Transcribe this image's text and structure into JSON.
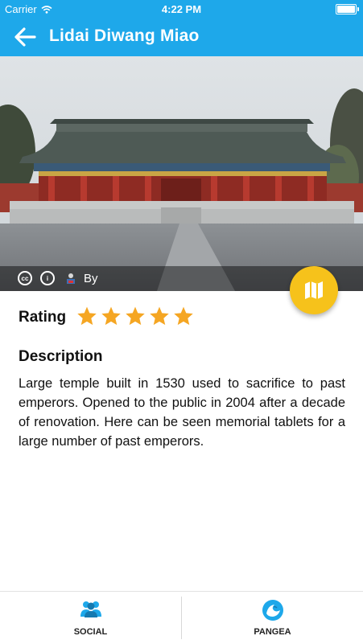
{
  "status_bar": {
    "carrier": "Carrier",
    "time": "4:22 PM"
  },
  "nav": {
    "title": "Lidai Diwang Miao",
    "back_icon": "arrow-left-icon"
  },
  "hero": {
    "attribution": "By"
  },
  "rating": {
    "label": "Rating",
    "stars": 5,
    "max": 5
  },
  "description": {
    "heading": "Description",
    "text": "Large temple built in 1530 used to sacrifice to past emperors. Opened to the public in 2004 after a decade of renovation. Here can be seen memorial tablets for a large number of past emperors."
  },
  "tabs": [
    {
      "label": "SOCIAL",
      "icon": "people-icon"
    },
    {
      "label": "PANGEA",
      "icon": "wave-icon"
    }
  ],
  "colors": {
    "primary": "#1ea8ea",
    "accent": "#f6c21b",
    "star": "#f5a623"
  }
}
